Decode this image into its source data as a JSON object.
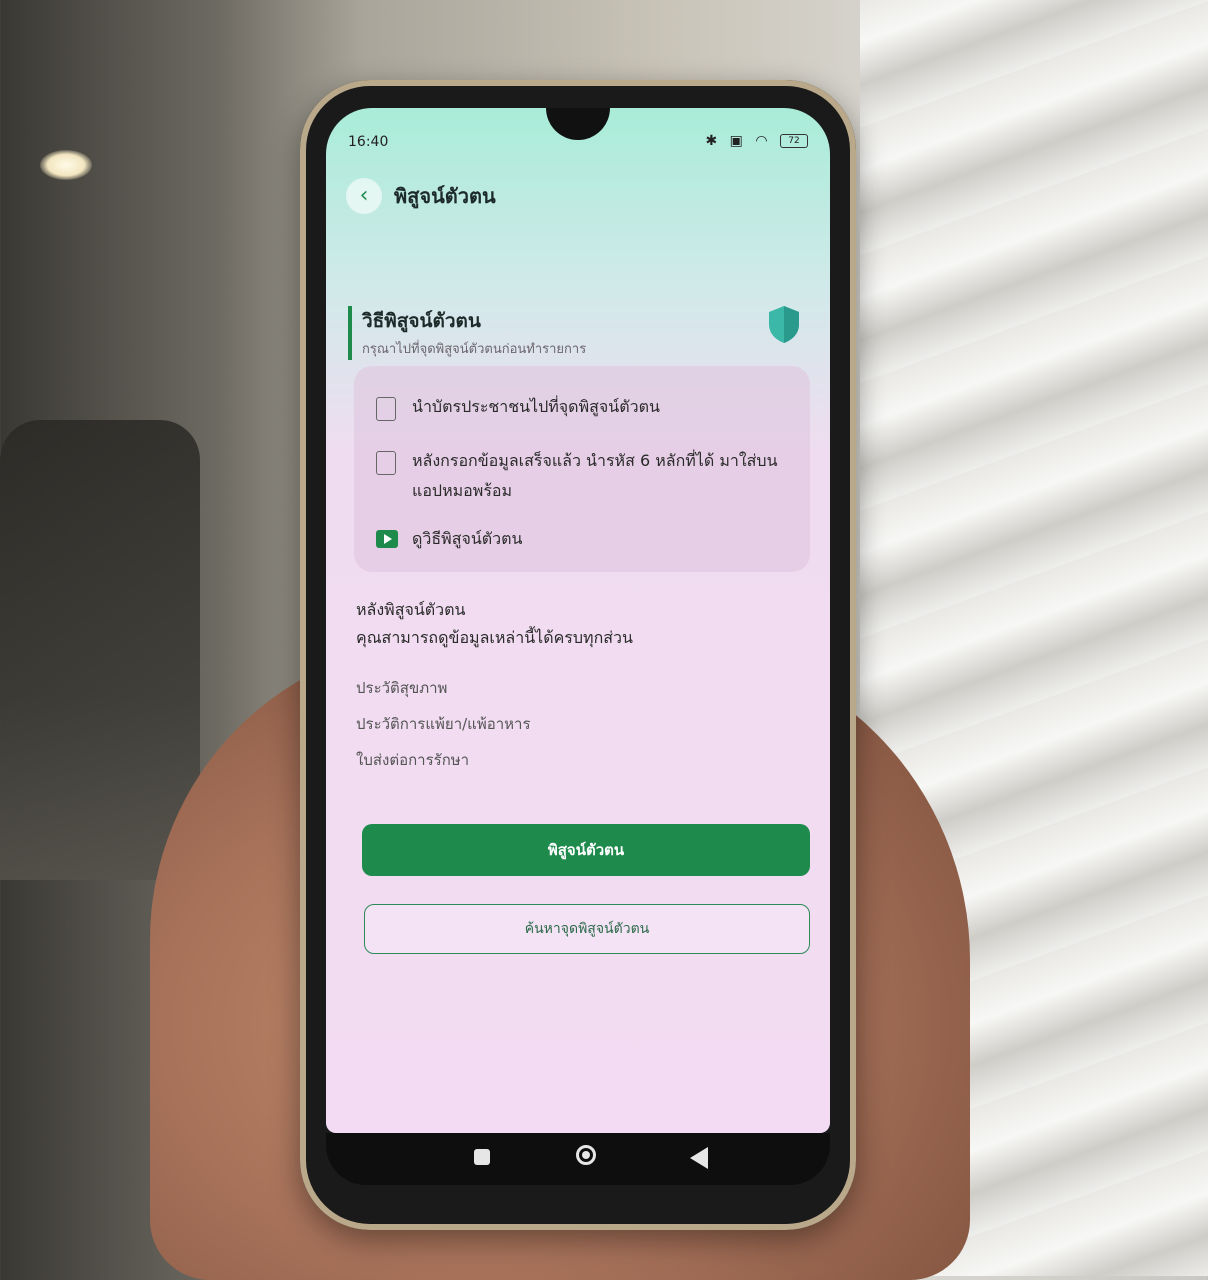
{
  "status": {
    "time": "16:40",
    "battery": "72",
    "icons": [
      "bluetooth-icon",
      "sim-icon",
      "wifi-icon"
    ]
  },
  "header": {
    "title": "พิสูจน์ตัวตน"
  },
  "section": {
    "title": "วิธีพิสูจน์ตัวตน",
    "subtitle": "กรุณาไปที่จุดพิสูจน์ตัวตนก่อนทำรายการ"
  },
  "steps": [
    {
      "text": "นำบัตรประชาชนไปที่จุดพิสูจน์ตัวตน"
    },
    {
      "text": "หลังกรอกข้อมูลเสร็จแล้ว นำรหัส 6 หลักที่ได้ มาใส่บนแอปหมอพร้อม"
    },
    {
      "text": "ดูวิธีพิสูจน์ตัวตน"
    }
  ],
  "after": {
    "line1": "หลังพิสูจน์ตัวตน",
    "line2": "คุณสามารถดูข้อมูลเหล่านี้ได้ครบทุกส่วน",
    "items": [
      "ประวัติสุขภาพ",
      "ประวัติการแพ้ยา/แพ้อาหาร",
      "ใบส่งต่อการรักษา"
    ]
  },
  "buttons": {
    "primary": "พิสูจน์ตัวตน",
    "secondary": "ค้นหาจุดพิสูจน์ตัวตน"
  },
  "colors": {
    "accent": "#1e8a4c",
    "shield": "#3bb8a8"
  }
}
